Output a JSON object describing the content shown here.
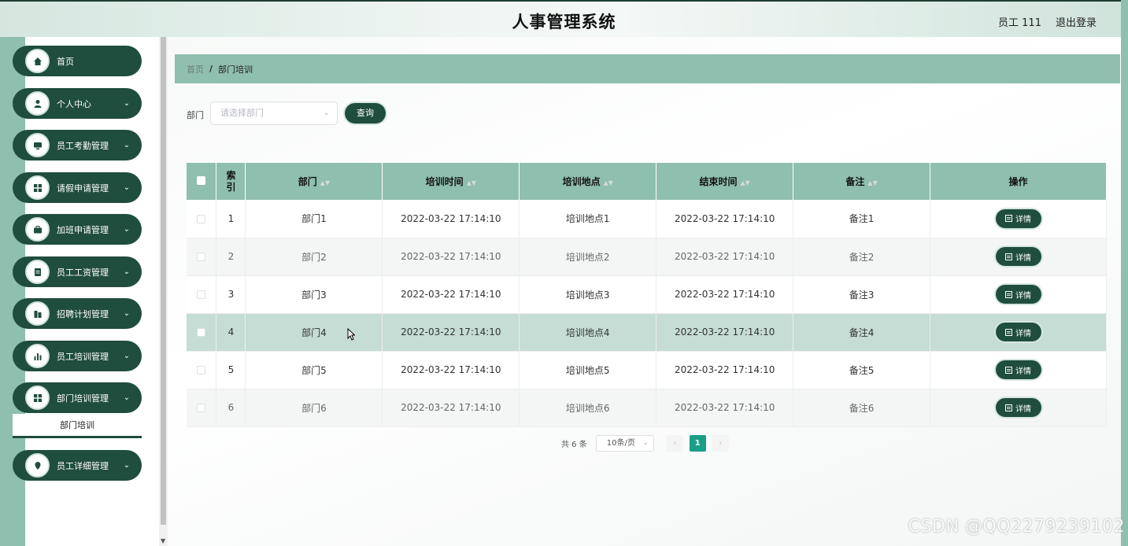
{
  "header": {
    "title": "人事管理系统",
    "user": "员工 111",
    "logout": "退出登录"
  },
  "sidebar": {
    "items": [
      {
        "label": "首页",
        "icon": "home-icon",
        "has_chevron": false
      },
      {
        "label": "个人中心",
        "icon": "user-icon",
        "has_chevron": true
      },
      {
        "label": "员工考勤管理",
        "icon": "monitor-icon",
        "has_chevron": true
      },
      {
        "label": "请假申请管理",
        "icon": "grid-icon",
        "has_chevron": true
      },
      {
        "label": "加班申请管理",
        "icon": "briefcase-icon",
        "has_chevron": true
      },
      {
        "label": "员工工资管理",
        "icon": "document-icon",
        "has_chevron": true
      },
      {
        "label": "招聘计划管理",
        "icon": "building-icon",
        "has_chevron": true
      },
      {
        "label": "员工培训管理",
        "icon": "bar-chart-icon",
        "has_chevron": true
      },
      {
        "label": "部门培训管理",
        "icon": "grid-icon",
        "has_chevron": true,
        "expanded": true
      },
      {
        "label": "员工详细管理",
        "icon": "location-icon",
        "has_chevron": true
      }
    ],
    "submenu": {
      "label": "部门培训"
    }
  },
  "breadcrumb": {
    "home": "首页",
    "separator": "/",
    "current": "部门培训"
  },
  "filter": {
    "label": "部门",
    "placeholder": "请选择部门",
    "query_button": "查询"
  },
  "table": {
    "headers": {
      "index": "索引",
      "dept": "部门",
      "train_time": "培训时间",
      "location": "培训地点",
      "end_time": "结束时间",
      "remark": "备注",
      "action": "操作"
    },
    "detail_label": "详情",
    "rows": [
      {
        "index": "1",
        "dept": "部门1",
        "train_time": "2022-03-22 17:14:10",
        "location": "培训地点1",
        "end_time": "2022-03-22 17:14:10",
        "remark": "备注1"
      },
      {
        "index": "2",
        "dept": "部门2",
        "train_time": "2022-03-22 17:14:10",
        "location": "培训地点2",
        "end_time": "2022-03-22 17:14:10",
        "remark": "备注2"
      },
      {
        "index": "3",
        "dept": "部门3",
        "train_time": "2022-03-22 17:14:10",
        "location": "培训地点3",
        "end_time": "2022-03-22 17:14:10",
        "remark": "备注3"
      },
      {
        "index": "4",
        "dept": "部门4",
        "train_time": "2022-03-22 17:14:10",
        "location": "培训地点4",
        "end_time": "2022-03-22 17:14:10",
        "remark": "备注4"
      },
      {
        "index": "5",
        "dept": "部门5",
        "train_time": "2022-03-22 17:14:10",
        "location": "培训地点5",
        "end_time": "2022-03-22 17:14:10",
        "remark": "备注5"
      },
      {
        "index": "6",
        "dept": "部门6",
        "train_time": "2022-03-22 17:14:10",
        "location": "培训地点6",
        "end_time": "2022-03-22 17:14:10",
        "remark": "备注6"
      }
    ]
  },
  "pagination": {
    "total": "共 6 条",
    "page_size": "10条/页",
    "prev": "‹",
    "current_page": "1",
    "next": "›"
  },
  "watermark": "CSDN @QQ2279239102",
  "colors": {
    "primary": "#1f4d3e",
    "accent": "#8fbfae",
    "active_page": "#1a9f87"
  }
}
